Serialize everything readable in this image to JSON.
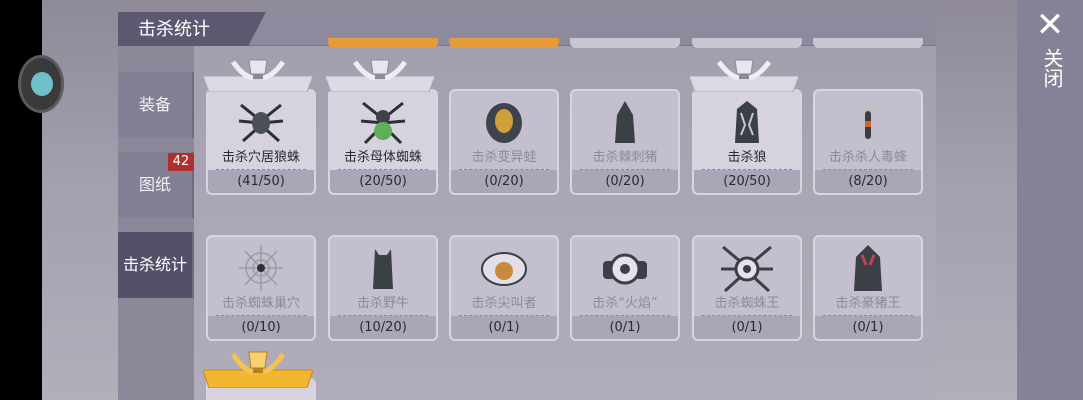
{
  "header": {
    "title": "击杀统计"
  },
  "close": {
    "label": "关闭"
  },
  "sidebar": {
    "items": [
      {
        "label": "装备"
      },
      {
        "label": "图纸",
        "badge": "42"
      },
      {
        "label": "击杀统计"
      }
    ]
  },
  "cards": [
    {
      "name": "击杀穴居狼蛛",
      "count": "(41/50)",
      "trophy": "silver",
      "icon": "spider-icon"
    },
    {
      "name": "击杀母体蜘蛛",
      "count": "(20/50)",
      "trophy": "silver",
      "icon": "spider-icon"
    },
    {
      "name": "击杀变异蛙",
      "count": "(0/20)",
      "trophy": "",
      "icon": "frog-icon"
    },
    {
      "name": "击杀棘刺猪",
      "count": "(0/20)",
      "trophy": "",
      "icon": "boar-icon"
    },
    {
      "name": "击杀狼",
      "count": "(20/50)",
      "trophy": "silver",
      "icon": "wolf-icon"
    },
    {
      "name": "击杀杀人毒蜂",
      "count": "(8/20)",
      "trophy": "",
      "icon": "wasp-icon"
    },
    {
      "name": "击杀蜘蛛巢穴",
      "count": "(0/10)",
      "trophy": "",
      "icon": "web-icon"
    },
    {
      "name": "击杀野牛",
      "count": "(10/20)",
      "trophy": "",
      "icon": "bison-icon"
    },
    {
      "name": "击杀尖叫者",
      "count": "(0/1)",
      "trophy": "",
      "icon": "screamer-icon"
    },
    {
      "name": "击杀“火焰”",
      "count": "(0/1)",
      "trophy": "",
      "icon": "flame-boss-icon"
    },
    {
      "name": "击杀蜘蛛王",
      "count": "(0/1)",
      "trophy": "",
      "icon": "spider-king-icon"
    },
    {
      "name": "击杀豪猪王",
      "count": "(0/1)",
      "trophy": "",
      "icon": "porcupine-king-icon"
    }
  ],
  "colors": {
    "silver": "#e0dfe6",
    "gold": "#f2b630",
    "accent_orange": "#e69a38"
  }
}
